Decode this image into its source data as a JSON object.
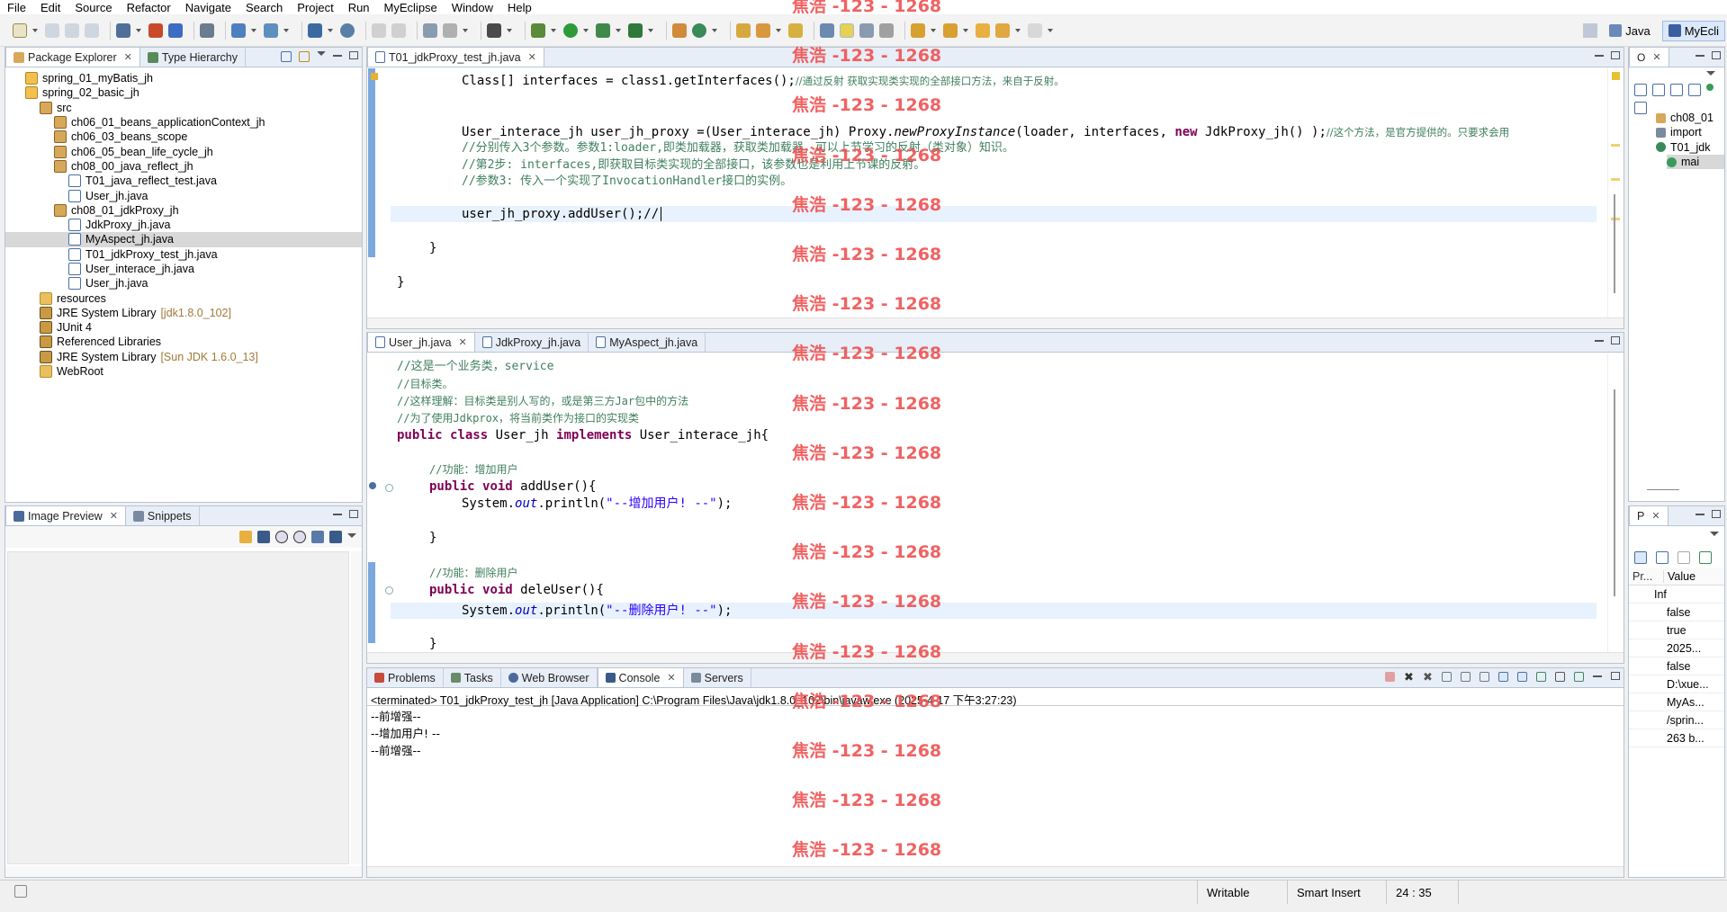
{
  "menu": [
    "File",
    "Edit",
    "Source",
    "Refactor",
    "Navigate",
    "Search",
    "Project",
    "Run",
    "MyEclipse",
    "Window",
    "Help"
  ],
  "perspectives": {
    "java": "Java",
    "myeclipse": "MyEcli"
  },
  "package_explorer": {
    "tabs": [
      "Package Explorer",
      "Type Hierarchy"
    ],
    "items": [
      {
        "label": "spring_01_myBatis_jh",
        "indent": 0,
        "icon": "project-icon"
      },
      {
        "label": "spring_02_basic_jh",
        "indent": 0,
        "icon": "project-icon"
      },
      {
        "label": "src",
        "indent": 1,
        "icon": "source-folder-icon"
      },
      {
        "label": "ch06_01_beans_applicationContext_jh",
        "indent": 2,
        "icon": "package-icon"
      },
      {
        "label": "ch06_03_beans_scope",
        "indent": 2,
        "icon": "package-icon"
      },
      {
        "label": "ch06_05_bean_life_cycle_jh",
        "indent": 2,
        "icon": "package-icon"
      },
      {
        "label": "ch08_00_java_reflect_jh",
        "indent": 2,
        "icon": "package-icon"
      },
      {
        "label": "T01_java_reflect_test.java",
        "indent": 3,
        "icon": "java-file-icon"
      },
      {
        "label": "User_jh.java",
        "indent": 3,
        "icon": "java-file-icon"
      },
      {
        "label": "ch08_01_jdkProxy_jh",
        "indent": 2,
        "icon": "package-icon"
      },
      {
        "label": "JdkProxy_jh.java",
        "indent": 3,
        "icon": "java-file-icon"
      },
      {
        "label": "MyAspect_jh.java",
        "indent": 3,
        "icon": "java-file-icon"
      },
      {
        "label": "T01_jdkProxy_test_jh.java",
        "indent": 3,
        "icon": "java-file-icon"
      },
      {
        "label": "User_interace_jh.java",
        "indent": 3,
        "icon": "java-file-icon"
      },
      {
        "label": "User_jh.java",
        "indent": 3,
        "icon": "java-file-icon"
      },
      {
        "label": "resources",
        "indent": 1,
        "icon": "folder-icon"
      },
      {
        "label": "JRE System Library",
        "suffix": "[jdk1.8.0_102]",
        "indent": 1,
        "icon": "library-icon"
      },
      {
        "label": "JUnit 4",
        "indent": 1,
        "icon": "library-icon"
      },
      {
        "label": "Referenced Libraries",
        "indent": 1,
        "icon": "library-icon"
      },
      {
        "label": "JRE System Library",
        "suffix": "[Sun JDK 1.6.0_13]",
        "indent": 1,
        "icon": "library-icon"
      },
      {
        "label": "WebRoot",
        "indent": 1,
        "icon": "folder-icon"
      }
    ],
    "selected_index": 11
  },
  "image_preview": {
    "tabs": [
      "Image Preview",
      "Snippets"
    ]
  },
  "editor_top": {
    "tab": "T01_jdkProxy_test_jh.java",
    "lines": {
      "l1_code": "Class[] interfaces = class1.getInterfaces();",
      "l1_comment": "//通过反射 获取实现类实现的全部接口方法，来自于反射。",
      "l2_a": "User_interace_jh user_jh_proxy =(User_interace_jh) Proxy.",
      "l2_b": "newProxyInstance",
      "l2_c": "(loader, interfaces, ",
      "l2_kw": "new",
      "l2_d": " JdkProxy_jh() );",
      "l2_comment": "//这个方法，是官方提供的。只要求会用",
      "l3": "//分别传入3个参数。参数1:loader,即类加载器，获取类加载器，可以上节学习的反射（类对象）知识。",
      "l4": "//第2步: interfaces,即获取目标类实现的全部接口，该参数也是利用上节课的反射。",
      "l5": "//参数3: 传入一个实现了InvocationHandler接口的实例。",
      "l6": "user_jh_proxy.addUser();//",
      "l7": "}",
      "l8": "}"
    }
  },
  "editor_bottom": {
    "tabs": [
      "User_jh.java",
      "JdkProxy_jh.java",
      "MyAspect_jh.java"
    ],
    "lines": {
      "c1": "//这是一个业务类，service",
      "c2": "//目标类。",
      "c3": "//这样理解：目标类是别人写的，或是第三方Jar包中的方法",
      "c4": "//为了使用Jdkprox，将当前类作为接口的实现类",
      "cls_public": "public",
      "cls_class": "class",
      "cls_name": " User_jh ",
      "cls_impl": "implements",
      "cls_rest": " User_interace_jh{",
      "m1_comment": "//功能：增加用户",
      "m1_sig_a": "public",
      "m1_sig_b": "void",
      "m1_sig_c": " addUser(){",
      "m1_body_a": "System.",
      "m1_body_out": "out",
      "m1_body_b": ".println(",
      "m1_str": "\"--增加用户! --\"",
      "m1_end": ");",
      "m1_close": "}",
      "m2_comment": "//功能：删除用户",
      "m2_sig_c": " deleUser(){",
      "m2_str": "\"--删除用户! --\"",
      "m2_close": "}"
    }
  },
  "console": {
    "tabs": [
      "Problems",
      "Tasks",
      "Web Browser",
      "Console",
      "Servers"
    ],
    "terminated": "<terminated> T01_jdkProxy_test_jh [Java Application] C:\\Program Files\\Java\\jdk1.8.0_102\\bin\\javaw.exe (2025-4-17 下午3:27:23)",
    "output": [
      "--前增强--",
      "--增加用户! --",
      "--前增强--"
    ]
  },
  "outline": {
    "items": [
      "ch08_01",
      "import",
      "T01_jdk",
      "mai"
    ]
  },
  "properties": {
    "tab": "P",
    "headers": [
      "Pr...",
      "Value"
    ],
    "group": "Inf",
    "values": [
      "false",
      "true",
      "2025...",
      "false",
      "D:\\xue...",
      "MyAs...",
      "/sprin...",
      "263  b..."
    ]
  },
  "status": {
    "writable": "Writable",
    "insert": "Smart Insert",
    "position": "24 : 35"
  },
  "watermark": "焦浩 -123 - 1268"
}
